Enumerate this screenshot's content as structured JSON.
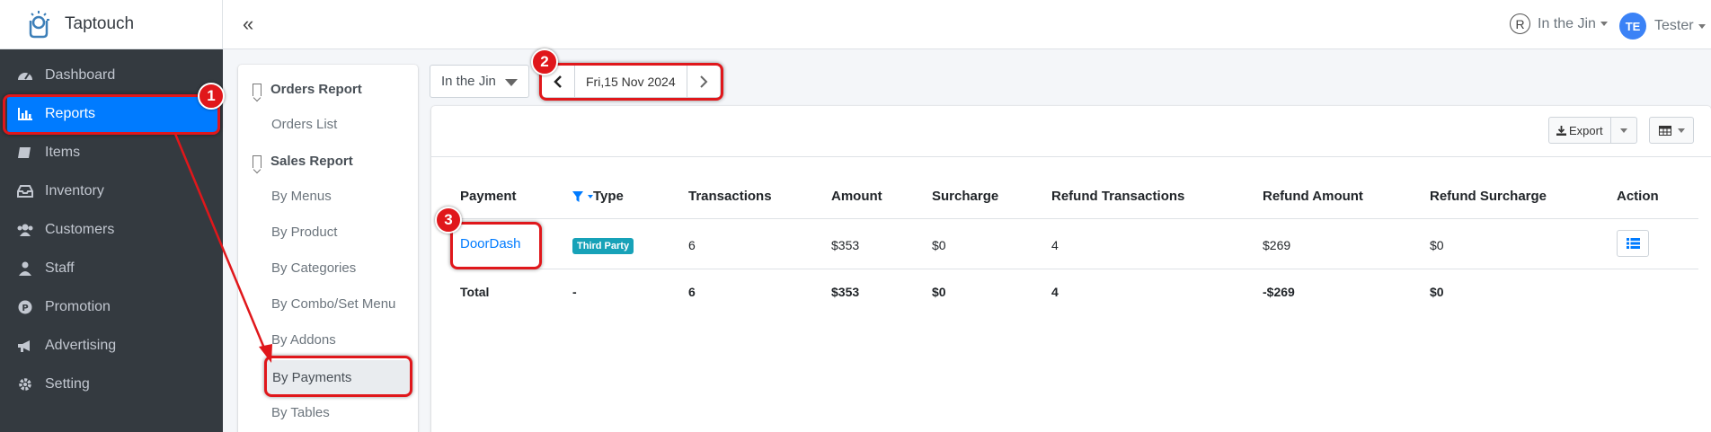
{
  "brand": {
    "name": "Taptouch"
  },
  "topbar": {
    "collapse_icon": "«",
    "store_icon_text": "R",
    "store_name": "In the Jin",
    "user_initials": "TE",
    "user_name": "Tester"
  },
  "sidebar": {
    "items": [
      {
        "label": "Dashboard",
        "icon": "dashboard-icon"
      },
      {
        "label": "Reports",
        "icon": "bar-chart-icon",
        "active": true
      },
      {
        "label": "Items",
        "icon": "book-icon"
      },
      {
        "label": "Inventory",
        "icon": "inbox-icon"
      },
      {
        "label": "Customers",
        "icon": "users-icon"
      },
      {
        "label": "Staff",
        "icon": "user-tie-icon"
      },
      {
        "label": "Promotion",
        "icon": "promotion-icon"
      },
      {
        "label": "Advertising",
        "icon": "bullhorn-icon"
      },
      {
        "label": "Setting",
        "icon": "gear-icon"
      }
    ]
  },
  "submenu": {
    "orders_heading": "Orders Report",
    "orders_list": "Orders List",
    "sales_heading": "Sales Report",
    "links": [
      "By Menus",
      "By Product",
      "By Categories",
      "By Combo/Set Menu",
      "By Addons",
      "By Payments",
      "By Tables"
    ]
  },
  "toolbar": {
    "store_select": "In the Jin",
    "date": "Fri,15 Nov 2024"
  },
  "card": {
    "export_label": "Export"
  },
  "table": {
    "headers": [
      "Payment",
      "Type",
      "Transactions",
      "Amount",
      "Surcharge",
      "Refund Transactions",
      "Refund Amount",
      "Refund Surcharge",
      "Action"
    ],
    "row": {
      "payment": "DoorDash",
      "type_badge": "Third Party",
      "transactions": "6",
      "amount": "$353",
      "surcharge": "$0",
      "refund_transactions": "4",
      "refund_amount": "$269",
      "refund_surcharge": "$0"
    },
    "total": {
      "label": "Total",
      "type": "-",
      "transactions": "6",
      "amount": "$353",
      "surcharge": "$0",
      "refund_transactions": "4",
      "refund_amount": "-$269",
      "refund_surcharge": "$0"
    }
  },
  "annotations": {
    "step1": "1",
    "step2": "2",
    "step3": "3",
    "color": "#e0171b"
  },
  "colors": {
    "sidebar_bg": "#343a40",
    "active_bg": "#007bff",
    "badge_bg": "#17a2b8",
    "link": "#007bff"
  }
}
